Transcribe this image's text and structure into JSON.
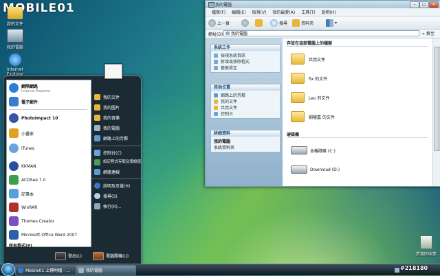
{
  "watermark": "MOBILE01",
  "watermark_id": "#218180",
  "desktop_icons": [
    {
      "label": "我的文件",
      "icon": "user-folder-icon"
    },
    {
      "label": "我的電腦",
      "icon": "computer-icon"
    },
    {
      "label": "Internet Explorer",
      "icon": "ie-icon"
    }
  ],
  "recycle_bin": {
    "label": "資源回收筒",
    "icon": "recycle-bin-icon"
  },
  "start_menu": {
    "pinned": [
      {
        "title": "網際網路",
        "subtitle": "Internet Explorer",
        "icon": "ie-icon",
        "color": "#2a7fd4"
      },
      {
        "title": "電子郵件",
        "subtitle": "",
        "icon": "mail-icon",
        "color": "#3b7ad1"
      }
    ],
    "recent": [
      {
        "title": "PhotoImpact 10",
        "icon": "photoimpact-icon",
        "color": "#3355aa"
      },
      {
        "title": "小畫家",
        "icon": "paint-icon",
        "color": "#e0a020"
      },
      {
        "title": "iTunes",
        "icon": "itunes-icon",
        "color": "#6aa4e0"
      },
      {
        "title": "KKMAN",
        "icon": "kkman-icon",
        "color": "#2a4f9a"
      },
      {
        "title": "ACDSee 7.0",
        "icon": "acdsee-icon",
        "color": "#3aa050"
      },
      {
        "title": "記事本",
        "icon": "notepad-icon",
        "color": "#5aa0d8"
      },
      {
        "title": "WinRAR",
        "icon": "winrar-icon",
        "color": "#b03030"
      },
      {
        "title": "Themes Creator",
        "icon": "themes-icon",
        "color": "#7a4fc0"
      },
      {
        "title": "Microsoft Office Word 2007",
        "icon": "word-icon",
        "color": "#2b5faa"
      }
    ],
    "all_programs": "所有程式(P)",
    "right": [
      {
        "label": "我的文件",
        "icon": "folder-icon"
      },
      {
        "label": "我的圖片",
        "icon": "pictures-icon"
      },
      {
        "label": "我的音樂",
        "icon": "music-icon"
      },
      {
        "label": "我的電腦",
        "icon": "computer-icon"
      },
      {
        "label": "網路上的芳鄰",
        "icon": "network-icon"
      }
    ],
    "right2": [
      {
        "label": "控制台(C)",
        "icon": "control-panel-icon"
      },
      {
        "label": "設定程式存取及預設值",
        "icon": "defaults-icon"
      },
      {
        "label": "網路連線",
        "icon": "network-connection-icon"
      }
    ],
    "right3": [
      {
        "label": "說明及支援(H)",
        "icon": "help-icon"
      },
      {
        "label": "搜尋(S)",
        "icon": "search-icon"
      },
      {
        "label": "執行(R)...",
        "icon": "run-icon"
      }
    ],
    "logoff": "登出(L)",
    "shutdown": "電腦關機(U)"
  },
  "taskbar": {
    "buttons": [
      {
        "label": "Mobile01 上傳附檔 - ...",
        "icon": "ie-icon"
      },
      {
        "label": "我的電腦",
        "icon": "computer-icon"
      }
    ]
  },
  "explorer": {
    "title": "我的電腦",
    "menus": [
      "檔案(F)",
      "編輯(E)",
      "檢視(V)",
      "我的最愛(A)",
      "工具(T)",
      "說明(H)"
    ],
    "back_label": "上一頁",
    "search_label": "搜尋",
    "folders_label": "資料夾",
    "address_label": "網址(D)",
    "address_value": "我的電腦",
    "go_label": "移至",
    "tasks": {
      "system_title": "系統工作",
      "system_items": [
        "檢視系統資訊",
        "新增或移除程式",
        "變更設定"
      ],
      "other_title": "其他位置",
      "other_items": [
        "網路上的芳鄰",
        "我的文件",
        "共用文件",
        "控制台"
      ],
      "details_title": "詳細資料",
      "details_name": "我的電腦",
      "details_sub": "系統資料夾"
    },
    "files_header": "存放在這部電腦上的檔案",
    "files": [
      "共用文件",
      "fix 的文件",
      "Leo 的文件",
      "劉曜嘉 的文件"
    ],
    "drives_header": "硬碟機",
    "drives": [
      "本機磁碟 (C:)",
      "Download (D:)"
    ]
  },
  "colors": {
    "task_header": "#1f4e79",
    "folder": "#f0c64a"
  }
}
